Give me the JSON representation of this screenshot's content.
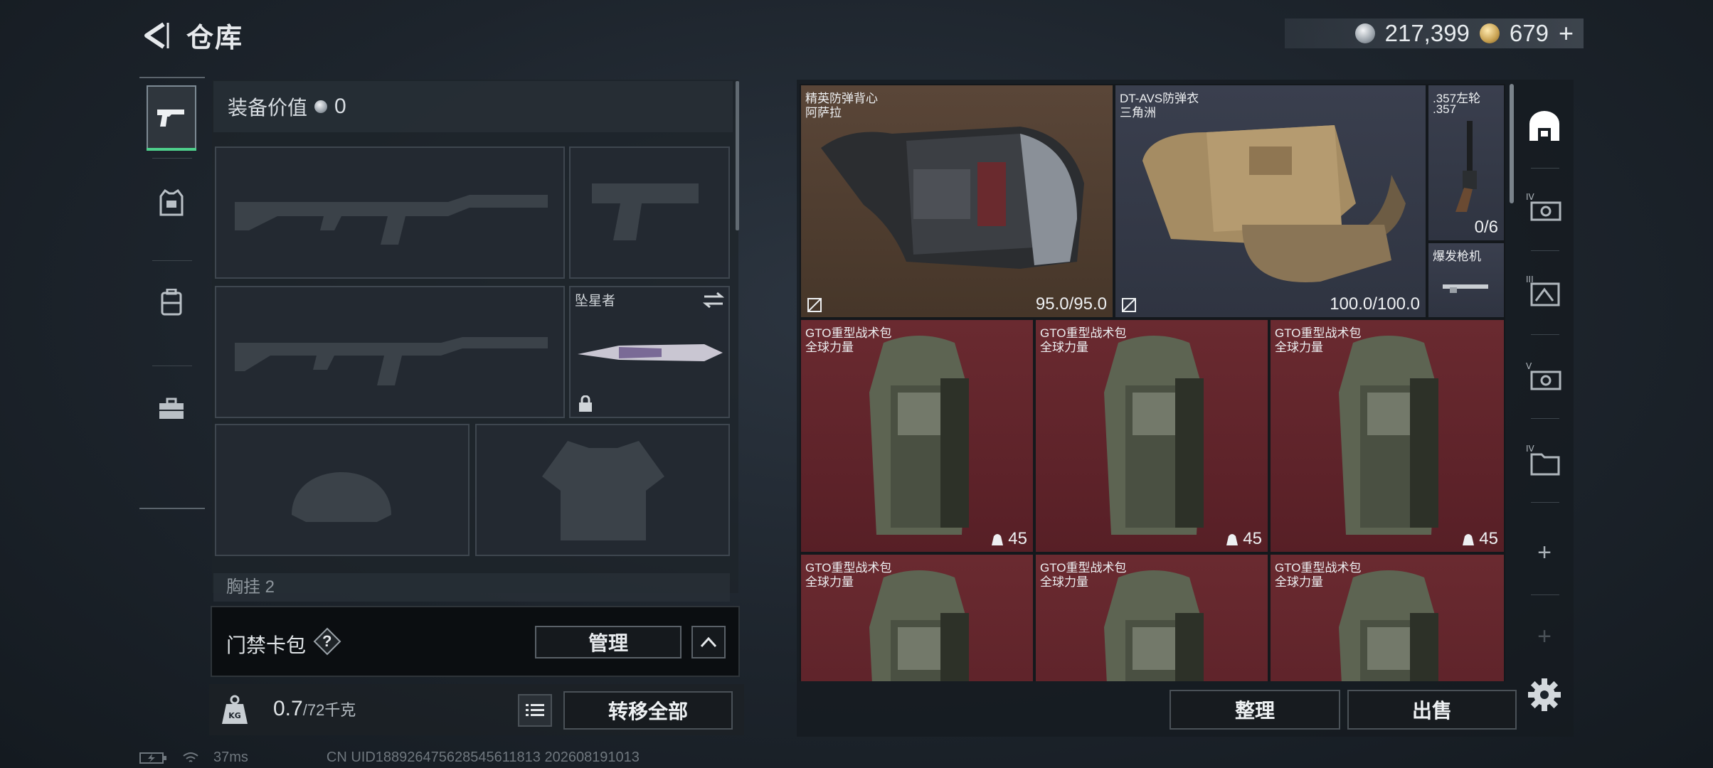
{
  "header": {
    "title": "仓库",
    "silver_amount": "217,399",
    "gold_amount": "679",
    "gold_plus": "+"
  },
  "equipment": {
    "value_label": "装备价值",
    "value_amount": "0",
    "melee_name": "坠星者",
    "chest_label": "胸挂 2",
    "keycard_label": "门禁卡包",
    "keycard_help": "?",
    "manage_label": "管理",
    "weight_value": "0.7",
    "weight_capacity": "/72千克",
    "transfer_all_label": "转移全部"
  },
  "inventory": {
    "items": [
      {
        "line1": "精英防弹背心",
        "line2": "阿萨拉",
        "durability": "95.0/95.0"
      },
      {
        "line1": "DT-AVS防弹衣",
        "line2": "三角洲",
        "durability": "100.0/100.0"
      },
      {
        "line1": ".357左轮",
        "line2": ".357",
        "count": "0/6"
      },
      {
        "line1": "爆发枪机"
      },
      {
        "line1": "GTO重型战术包",
        "line2": "全球力量",
        "capacity": "45"
      },
      {
        "line1": "GTO重型战术包",
        "line2": "全球力量",
        "capacity": "45"
      },
      {
        "line1": "GTO重型战术包",
        "line2": "全球力量",
        "capacity": "45"
      },
      {
        "line1": "GTO重型战术包",
        "line2": "全球力量"
      },
      {
        "line1": "GTO重型战术包",
        "line2": "全球力量"
      },
      {
        "line1": "GTO重型战术包",
        "line2": "全球力量"
      }
    ],
    "sort_label": "整理",
    "sell_label": "出售",
    "tabs": [
      "IV",
      "III",
      "V",
      "IV"
    ],
    "add_symbol": "+"
  },
  "status": {
    "ping": "37ms",
    "uid": "CN UID1889264756285456118​13 202608191013"
  },
  "colors": {
    "active_accent": "#4ed08c",
    "item_red": "#6a2a30",
    "item_brown": "#5a4638",
    "item_slate": "#3a3f4e"
  }
}
